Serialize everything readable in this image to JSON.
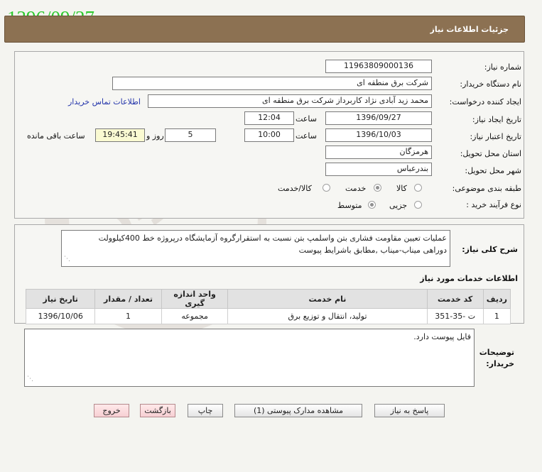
{
  "watermark_date": "1396/09/27",
  "header": {
    "title": "جزئیات اطلاعات نیاز"
  },
  "form": {
    "need_number": {
      "label": "شماره نیاز:",
      "value": "1196380900013​6"
    },
    "buyer_org": {
      "label": "نام دستگاه خریدار:",
      "value": "شرکت برق منطقه ای"
    },
    "creator": {
      "label": "ایجاد کننده درخواست:",
      "value": "محمد زید آبادی نژاد کاربرداز شرکت برق منطقه ای",
      "link": "اطلاعات تماس خریدار"
    },
    "created": {
      "label": "تاریخ ایجاد نیاز:",
      "date": "1396/09/27",
      "time_label": "ساعت",
      "time": "12:04"
    },
    "validity": {
      "label": "تاریخ اعتبار نیاز:",
      "date": "1396/10/03",
      "time_label": "ساعت",
      "time": "10:00",
      "days": "5",
      "days_label": "روز و",
      "remaining": "19:45:41",
      "remaining_label": "ساعت باقی مانده"
    },
    "province": {
      "label": "استان محل تحویل:",
      "value": "هرمزگان"
    },
    "city": {
      "label": "شهر محل تحویل:",
      "value": "بندرعباس"
    },
    "category": {
      "label": "طبقه بندی موضوعی:",
      "options": [
        "کالا",
        "خدمت",
        "کالا/خدمت"
      ],
      "selected": "خدمت"
    },
    "process": {
      "label": "نوع فرآیند خرید :",
      "options": [
        "جزیی",
        "متوسط"
      ],
      "selected": "متوسط"
    }
  },
  "description": {
    "label": "شرح کلی نیاز:",
    "line1": "عملیات تعیین مقاومت فشاری بتن واسلمپ بتن نسبت به استقرارگروه آزمایشگاه درپروژه خط 400کیلوولت",
    "line2": "دوراهی میناب-میناب    ,مطابق باشرایط پیوست"
  },
  "services": {
    "title": "اطلاعات خدمات مورد نیاز",
    "headers": [
      "ردیف",
      "کد خدمت",
      "نام خدمت",
      "واحد اندازه گیری",
      "تعداد / مقدار",
      "تاریخ نیاز"
    ],
    "rows": [
      [
        "1",
        "ت -35-351",
        "تولید، انتقال و توزیع برق",
        "مجموعه",
        "1",
        "1396/10/06"
      ]
    ]
  },
  "buyer_notes": {
    "label_line1": "توضیحات",
    "label_line2": "خریدار:",
    "value": "فایل پیوست دارد."
  },
  "buttons": {
    "reply": "پاسخ به نیاز",
    "view_docs": "مشاهده مدارک پیوستی (1)",
    "print": "چاپ",
    "back": "بازگشت",
    "exit": "خروج"
  },
  "watermark_text": {
    "main": "هزاره",
    "sub": "گستران",
    "extra": "ار"
  }
}
